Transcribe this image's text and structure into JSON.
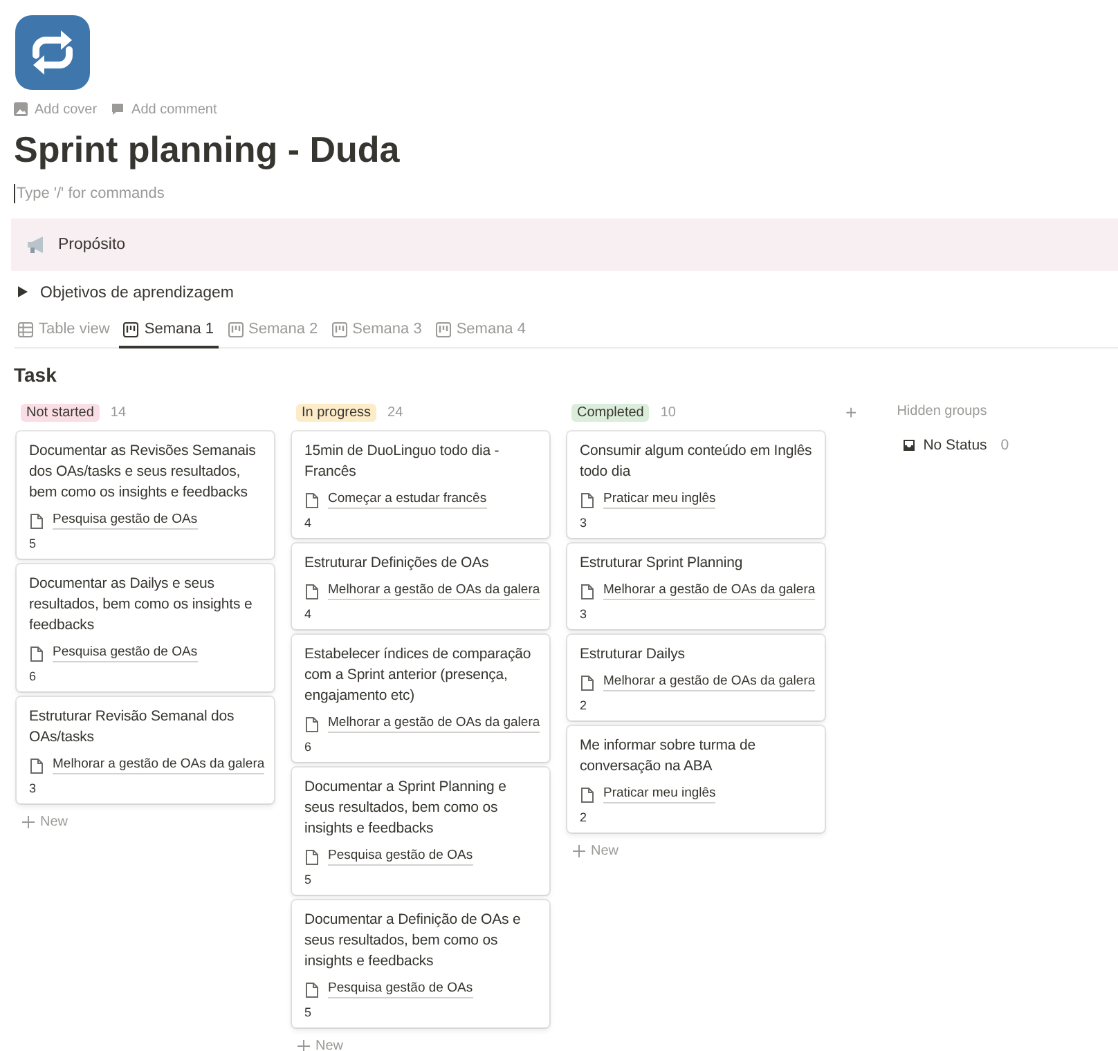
{
  "page": {
    "actions": [
      {
        "kind": "cover",
        "label": "Add cover"
      },
      {
        "kind": "comment",
        "label": "Add comment"
      }
    ],
    "title": "Sprint planning - Duda",
    "editor": {
      "placeholder": "Type '/' for commands"
    },
    "callout": {
      "text": "Propósito"
    },
    "toggle": {
      "label": "Objetivos de aprendizagem",
      "expanded": false
    }
  },
  "tabs": [
    {
      "kind": "table",
      "label": "Table view",
      "selected": false
    },
    {
      "kind": "board",
      "label": "Semana 1",
      "selected": true
    },
    {
      "kind": "board",
      "label": "Semana 2",
      "selected": false
    },
    {
      "kind": "board",
      "label": "Semana 3",
      "selected": false
    },
    {
      "kind": "board",
      "label": "Semana 4",
      "selected": false
    }
  ],
  "board": {
    "title": "Task",
    "groups": [
      {
        "label": "Not started",
        "count": "14",
        "color": "#fadee6",
        "new_label": "New",
        "cards": [
          {
            "title": "Documentar as Revisões Semanais dos OAs/tasks e seus resultados, bem como os insights e feedbacks",
            "relation": "Pesquisa gestão de OAs",
            "number": "5"
          },
          {
            "title": "Documentar as Dailys e seus resultados, bem como os insights e feedbacks",
            "relation": "Pesquisa gestão de OAs",
            "number": "6"
          },
          {
            "title": "Estruturar Revisão Semanal dos OAs/tasks",
            "relation": "Melhorar a gestão de OAs da galera",
            "number": "3"
          }
        ]
      },
      {
        "label": "In progress",
        "count": "24",
        "color": "#fdecc8",
        "new_label": "New",
        "cards": [
          {
            "title": "15min de DuoLinguo todo dia - Francês",
            "relation": "Começar a estudar francês",
            "number": "4"
          },
          {
            "title": "Estruturar Definições de OAs",
            "relation": "Melhorar a gestão de OAs da galera",
            "number": "4"
          },
          {
            "title": "Estabelecer índices de comparação com a Sprint anterior (presença, engajamento etc)",
            "relation": "Melhorar a gestão de OAs da galera",
            "number": "6"
          },
          {
            "title": "Documentar a Sprint Planning e seus resultados, bem como os insights e feedbacks",
            "relation": "Pesquisa gestão de OAs",
            "number": "5"
          },
          {
            "title": "Documentar a Definição de OAs e seus resultados, bem como os insights e feedbacks",
            "relation": "Pesquisa gestão de OAs",
            "number": "5"
          }
        ]
      },
      {
        "label": "Completed",
        "count": "10",
        "color": "#dbeddb",
        "new_label": "New",
        "cards": [
          {
            "title": "Consumir algum conteúdo em Inglês todo dia",
            "relation": "Praticar meu inglês",
            "number": "3"
          },
          {
            "title": "Estruturar Sprint Planning",
            "relation": "Melhorar a gestão de OAs da galera",
            "number": "3"
          },
          {
            "title": "Estruturar Dailys",
            "relation": "Melhorar a gestão de OAs da galera",
            "number": "2"
          },
          {
            "title": "Me informar sobre turma de conversação na ABA",
            "relation": "Praticar meu inglês",
            "number": "2"
          }
        ]
      }
    ],
    "add_group": "+",
    "hidden": {
      "title": "Hidden groups",
      "groups": [
        {
          "label": "No Status",
          "count": "0"
        }
      ]
    }
  }
}
